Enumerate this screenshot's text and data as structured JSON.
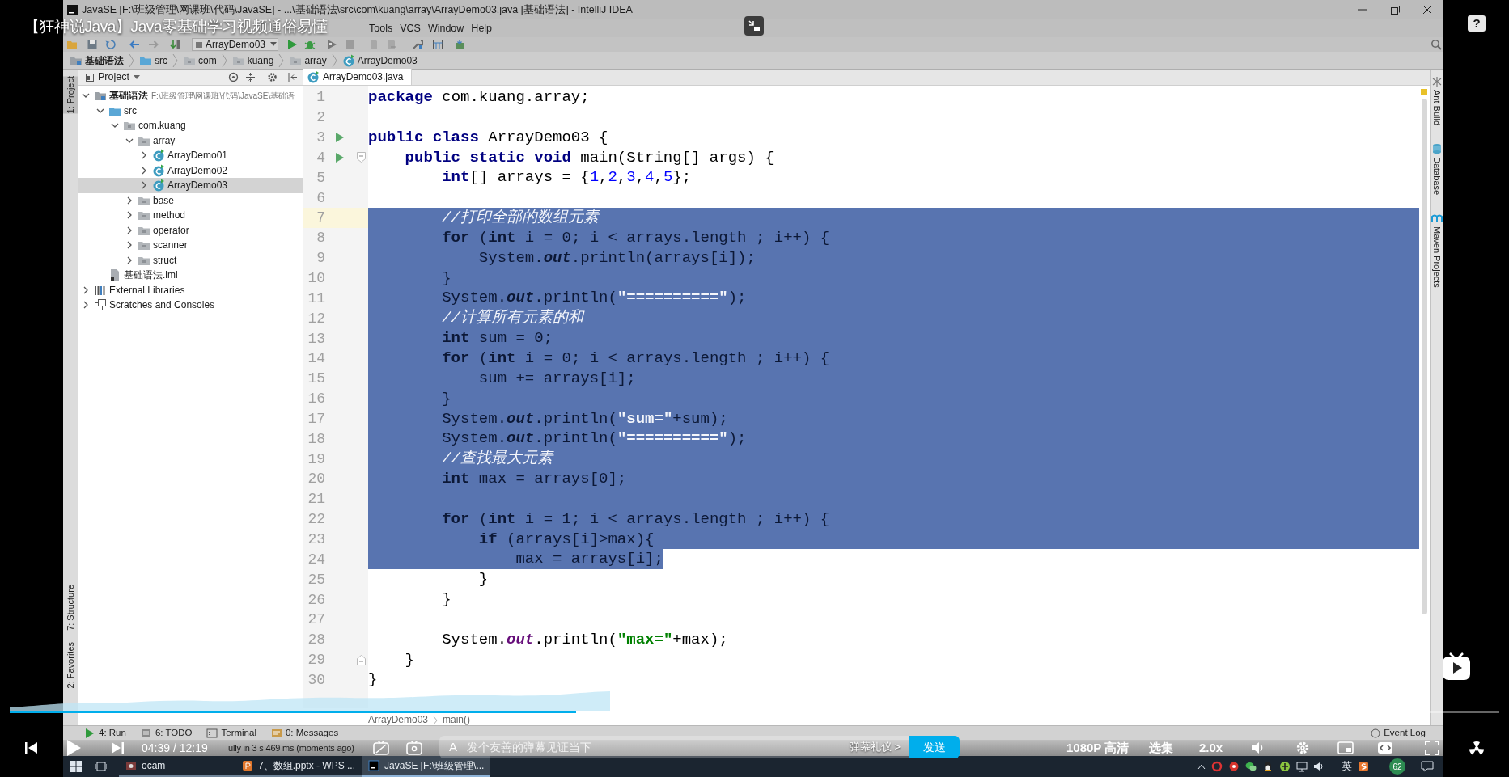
{
  "video": {
    "title": "【狂神说Java】Java零基础学习视频通俗易懂",
    "help": "?",
    "progress": {
      "level": 0.38
    },
    "time": "04:39 / 12:19",
    "danmaku": {
      "style_icon": "A",
      "placeholder": "发个友善的弹幕见证当下",
      "etiquette": "弹幕礼仪 >",
      "send": "发送"
    },
    "quality": "1080P 高清",
    "episodes": "选集",
    "speed": "2.0x"
  },
  "ide": {
    "title": "JavaSE [F:\\班级管理\\网课班\\代码\\JavaSE] - ...\\基础语法\\src\\com\\kuang\\array\\ArrayDemo03.java [基础语法] - IntelliJ IDEA",
    "menu": [
      "Tools",
      "VCS",
      "Window",
      "Help"
    ],
    "run_config": "ArrayDemo03",
    "breadcrumbs": [
      {
        "label": "基础语法",
        "kind": "module"
      },
      {
        "label": "src",
        "kind": "source"
      },
      {
        "label": "com",
        "kind": "package"
      },
      {
        "label": "kuang",
        "kind": "package"
      },
      {
        "label": "array",
        "kind": "package"
      },
      {
        "label": "ArrayDemo03",
        "kind": "class"
      }
    ],
    "left_tool_windows": [
      {
        "label": "1: Project",
        "selected": true
      },
      {
        "label": "7: Structure",
        "selected": false
      },
      {
        "label": "2: Favorites",
        "selected": false
      }
    ],
    "right_tool_windows": [
      {
        "label": "Ant Build",
        "kind": "ant"
      },
      {
        "label": "Database",
        "kind": "database"
      },
      {
        "label": "Maven Projects",
        "kind": "maven"
      }
    ],
    "project": {
      "title": "Project",
      "tree": [
        {
          "label": "基础语法",
          "path": "F:\\班级管理\\网课班\\代码\\JavaSE\\基础语",
          "kind": "module",
          "expanded": true,
          "selected": false,
          "children": [
            {
              "label": "src",
              "kind": "source",
              "expanded": true,
              "selected": false,
              "children": [
                {
                  "label": "com.kuang",
                  "kind": "package",
                  "expanded": true,
                  "selected": false,
                  "children": [
                    {
                      "label": "array",
                      "kind": "package",
                      "expanded": true,
                      "selected": false,
                      "children": [
                        {
                          "label": "ArrayDemo01",
                          "kind": "class",
                          "expanded": false,
                          "selected": false
                        },
                        {
                          "label": "ArrayDemo02",
                          "kind": "class",
                          "expanded": false,
                          "selected": false
                        },
                        {
                          "label": "ArrayDemo03",
                          "kind": "class",
                          "expanded": false,
                          "selected": true
                        }
                      ]
                    },
                    {
                      "label": "base",
                      "kind": "package",
                      "expanded": false,
                      "selected": false
                    },
                    {
                      "label": "method",
                      "kind": "package",
                      "expanded": false,
                      "selected": false
                    },
                    {
                      "label": "operator",
                      "kind": "package",
                      "expanded": false,
                      "selected": false
                    },
                    {
                      "label": "scanner",
                      "kind": "package",
                      "expanded": false,
                      "selected": false
                    },
                    {
                      "label": "struct",
                      "kind": "package",
                      "expanded": false,
                      "selected": false
                    }
                  ]
                }
              ]
            },
            {
              "label": "基础语法.iml",
              "kind": "file",
              "selected": false
            }
          ]
        },
        {
          "label": "External Libraries",
          "kind": "libraries",
          "expanded": false,
          "selected": false
        },
        {
          "label": "Scratches and Consoles",
          "kind": "scratches",
          "expanded": false,
          "selected": false
        }
      ]
    },
    "editor": {
      "tab": "ArrayDemo03.java",
      "lines": [
        {
          "number": "1",
          "selected": false,
          "tokens": [
            {
              "kind": "kw",
              "text": "package"
            },
            {
              "kind": "plain",
              "text": " com.kuang.array;"
            }
          ]
        },
        {
          "number": "2",
          "selected": false
        },
        {
          "number": "3",
          "selected": false,
          "run": true,
          "tokens": [
            {
              "kind": "kw",
              "text": "public class"
            },
            {
              "kind": "plain",
              "text": " ArrayDemo03 {"
            }
          ]
        },
        {
          "number": "4",
          "selected": false,
          "run": true,
          "fold_start": true,
          "tokens": [
            {
              "kind": "kw",
              "text": "    public static void"
            },
            {
              "kind": "plain",
              "text": " main(String[] args) {"
            }
          ]
        },
        {
          "number": "5",
          "selected": false,
          "tokens": [
            {
              "kind": "kw",
              "text": "        int"
            },
            {
              "kind": "plain",
              "text": "[] arrays = {"
            },
            {
              "kind": "num",
              "text": "1"
            },
            {
              "kind": "plain",
              "text": ","
            },
            {
              "kind": "num",
              "text": "2"
            },
            {
              "kind": "plain",
              "text": ","
            },
            {
              "kind": "num",
              "text": "3"
            },
            {
              "kind": "plain",
              "text": ","
            },
            {
              "kind": "num",
              "text": "4"
            },
            {
              "kind": "plain",
              "text": ","
            },
            {
              "kind": "num",
              "text": "5"
            },
            {
              "kind": "plain",
              "text": "};"
            }
          ]
        },
        {
          "number": "6",
          "selected": false
        },
        {
          "number": "7",
          "selected": true,
          "current": true,
          "tokens": [
            {
              "kind": "cm",
              "text": "        //打印全部的数组元素"
            }
          ]
        },
        {
          "number": "8",
          "selected": true,
          "tokens": [
            {
              "kind": "kw",
              "text": "        for"
            },
            {
              "kind": "plain",
              "text": " ("
            },
            {
              "kind": "kw",
              "text": "int"
            },
            {
              "kind": "plain",
              "text": " i = "
            },
            {
              "kind": "num",
              "text": "0"
            },
            {
              "kind": "plain",
              "text": "; i < arrays."
            },
            {
              "kind": "field",
              "text": "length"
            },
            {
              "kind": "plain",
              "text": " ; i++) {"
            }
          ]
        },
        {
          "number": "9",
          "selected": true,
          "tokens": [
            {
              "kind": "plain",
              "text": "            System."
            },
            {
              "kind": "static",
              "text": "out"
            },
            {
              "kind": "plain",
              "text": ".println(arrays[i]);"
            }
          ]
        },
        {
          "number": "10",
          "selected": true,
          "tokens": [
            {
              "kind": "plain",
              "text": "        }"
            }
          ]
        },
        {
          "number": "11",
          "selected": true,
          "tokens": [
            {
              "kind": "plain",
              "text": "        System."
            },
            {
              "kind": "static",
              "text": "out"
            },
            {
              "kind": "plain",
              "text": ".println("
            },
            {
              "kind": "str",
              "text": "\"==========\""
            },
            {
              "kind": "plain",
              "text": ");"
            }
          ]
        },
        {
          "number": "12",
          "selected": true,
          "tokens": [
            {
              "kind": "cm",
              "text": "        //计算所有元素的和"
            }
          ]
        },
        {
          "number": "13",
          "selected": true,
          "tokens": [
            {
              "kind": "kw",
              "text": "        int"
            },
            {
              "kind": "plain",
              "text": " sum = "
            },
            {
              "kind": "num",
              "text": "0"
            },
            {
              "kind": "plain",
              "text": ";"
            }
          ]
        },
        {
          "number": "14",
          "selected": true,
          "tokens": [
            {
              "kind": "kw",
              "text": "        for"
            },
            {
              "kind": "plain",
              "text": " ("
            },
            {
              "kind": "kw",
              "text": "int"
            },
            {
              "kind": "plain",
              "text": " i = "
            },
            {
              "kind": "num",
              "text": "0"
            },
            {
              "kind": "plain",
              "text": "; i < arrays."
            },
            {
              "kind": "field",
              "text": "length"
            },
            {
              "kind": "plain",
              "text": " ; i++) {"
            }
          ]
        },
        {
          "number": "15",
          "selected": true,
          "tokens": [
            {
              "kind": "plain",
              "text": "            sum += arrays[i];"
            }
          ]
        },
        {
          "number": "16",
          "selected": true,
          "tokens": [
            {
              "kind": "plain",
              "text": "        }"
            }
          ]
        },
        {
          "number": "17",
          "selected": true,
          "tokens": [
            {
              "kind": "plain",
              "text": "        System."
            },
            {
              "kind": "static",
              "text": "out"
            },
            {
              "kind": "plain",
              "text": ".println("
            },
            {
              "kind": "str",
              "text": "\"sum=\""
            },
            {
              "kind": "plain",
              "text": "+sum);"
            }
          ]
        },
        {
          "number": "18",
          "selected": true,
          "tokens": [
            {
              "kind": "plain",
              "text": "        System."
            },
            {
              "kind": "static",
              "text": "out"
            },
            {
              "kind": "plain",
              "text": ".println("
            },
            {
              "kind": "str",
              "text": "\"==========\""
            },
            {
              "kind": "plain",
              "text": ");"
            }
          ]
        },
        {
          "number": "19",
          "selected": true,
          "tokens": [
            {
              "kind": "cm",
              "text": "        //查找最大元素"
            }
          ]
        },
        {
          "number": "20",
          "selected": true,
          "tokens": [
            {
              "kind": "kw",
              "text": "        int"
            },
            {
              "kind": "plain",
              "text": " max = arrays["
            },
            {
              "kind": "num",
              "text": "0"
            },
            {
              "kind": "plain",
              "text": "];"
            }
          ]
        },
        {
          "number": "21",
          "selected": true
        },
        {
          "number": "22",
          "selected": true,
          "tokens": [
            {
              "kind": "kw",
              "text": "        for"
            },
            {
              "kind": "plain",
              "text": " ("
            },
            {
              "kind": "kw",
              "text": "int"
            },
            {
              "kind": "plain",
              "text": " i = "
            },
            {
              "kind": "num",
              "text": "1"
            },
            {
              "kind": "plain",
              "text": "; i < arrays."
            },
            {
              "kind": "field",
              "text": "length"
            },
            {
              "kind": "plain",
              "text": " ; i++) {"
            }
          ]
        },
        {
          "number": "23",
          "selected": true,
          "tokens": [
            {
              "kind": "kw",
              "text": "            if"
            },
            {
              "kind": "plain",
              "text": " (arrays[i]>max){"
            }
          ]
        },
        {
          "number": "24",
          "selected": true,
          "partial": true,
          "tokens": [
            {
              "kind": "plain",
              "text": "                max = arrays[i];"
            }
          ]
        },
        {
          "number": "25",
          "selected": false,
          "tokens": [
            {
              "kind": "plain",
              "text": "            }"
            }
          ]
        },
        {
          "number": "26",
          "selected": false,
          "tokens": [
            {
              "kind": "plain",
              "text": "        }"
            }
          ]
        },
        {
          "number": "27",
          "selected": false
        },
        {
          "number": "28",
          "selected": false,
          "tokens": [
            {
              "kind": "plain",
              "text": "        System."
            },
            {
              "kind": "static",
              "text": "out"
            },
            {
              "kind": "plain",
              "text": ".println("
            },
            {
              "kind": "str",
              "text": "\"max=\""
            },
            {
              "kind": "plain",
              "text": "+max);"
            }
          ]
        },
        {
          "number": "29",
          "selected": false,
          "fold_end": true,
          "tokens": [
            {
              "kind": "plain",
              "text": "    }"
            }
          ]
        },
        {
          "number": "30",
          "selected": false,
          "tokens": [
            {
              "kind": "plain",
              "text": "}"
            }
          ]
        }
      ],
      "breadcrumbs": [
        "ArrayDemo03",
        "main()"
      ]
    },
    "tool_buttons": [
      {
        "label": "4: Run",
        "kind": "run"
      },
      {
        "label": "6: TODO",
        "kind": "todo"
      },
      {
        "label": "Terminal",
        "kind": "terminal"
      },
      {
        "label": "0: Messages",
        "kind": "messages"
      }
    ],
    "event_log": "Event Log",
    "status": "ully in 3 s 469 ms (moments ago)"
  },
  "taskbar": {
    "items": [
      {
        "label": "ocam",
        "kind": "ocam",
        "selected": false
      },
      {
        "label": "7、数组.pptx - WPS ...",
        "kind": "wps",
        "selected": false
      },
      {
        "label": "JavaSE [F:\\班级管理\\...",
        "kind": "idea",
        "selected": true
      }
    ],
    "ime": "英",
    "badge": "62"
  }
}
